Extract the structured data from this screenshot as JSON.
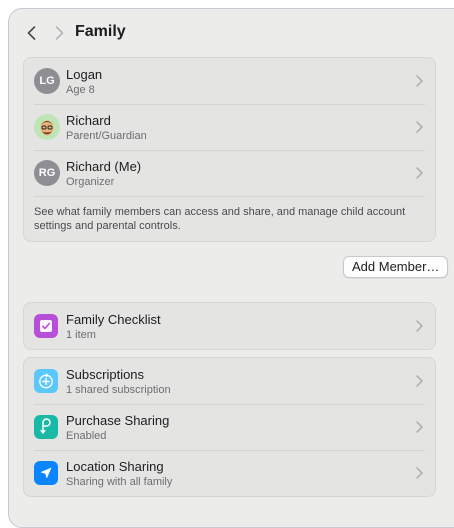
{
  "header": {
    "title": "Family",
    "back_icon": "chevron-left-icon",
    "forward_icon": "chevron-right-icon"
  },
  "family_members": [
    {
      "initials": "LG",
      "name": "Logan",
      "role": "Age 8"
    },
    {
      "initials": "",
      "name": "Richard",
      "role": "Parent/Guardian",
      "avatar": "memoji-avatar"
    },
    {
      "initials": "RG",
      "name": "Richard (Me)",
      "role": "Organizer"
    }
  ],
  "family_description": "See what family members can access and share, and manage child account settings and parental controls.",
  "add_member_label": "Add Member…",
  "checklist": {
    "title": "Family Checklist",
    "subtitle": "1 item",
    "icon": "checklist-icon",
    "color": "#b84fd8"
  },
  "services": [
    {
      "title": "Subscriptions",
      "subtitle": "1 shared subscription",
      "icon": "subscriptions-icon",
      "color": "#5ac8fa"
    },
    {
      "title": "Purchase Sharing",
      "subtitle": "Enabled",
      "icon": "purchase-sharing-icon",
      "color": "#19b9a6"
    },
    {
      "title": "Location Sharing",
      "subtitle": "Sharing with all family",
      "icon": "location-arrow-icon",
      "color": "#0a84ff"
    }
  ],
  "colors": {
    "window_bg": "#ececeb",
    "card_bg": "#e4e4e3",
    "avatar_gray": "#8e8e93"
  }
}
